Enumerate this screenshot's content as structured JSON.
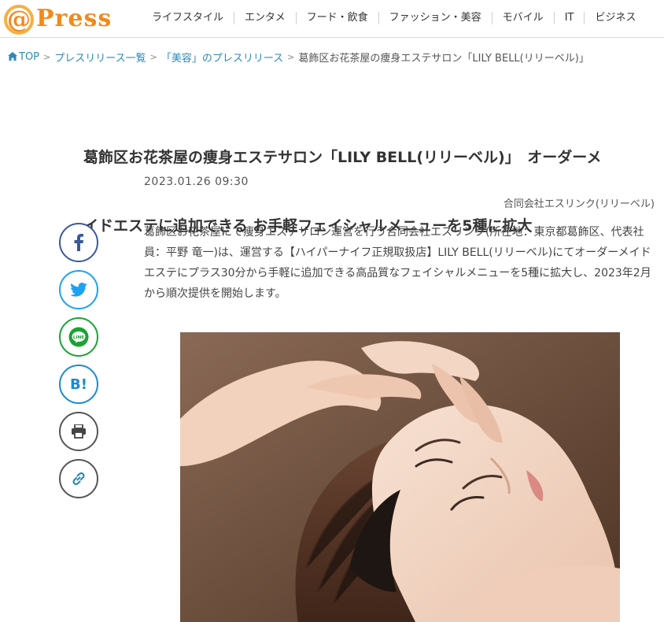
{
  "header": {
    "logo_at": "@",
    "logo_text": "Press",
    "nav": [
      {
        "label": "ライフスタイル"
      },
      {
        "label": "エンタメ"
      },
      {
        "label": "フード・飲食"
      },
      {
        "label": "ファッション・美容"
      },
      {
        "label": "モバイル"
      },
      {
        "label": "IT"
      },
      {
        "label": "ビジネス"
      }
    ]
  },
  "breadcrumb": {
    "home": "TOP",
    "list": "プレスリリース一覧",
    "category": "「美容」のプレスリリース",
    "current": "葛飾区お花茶屋の痩身エステサロン「LILY BELL(リリーベル)」"
  },
  "article": {
    "title_line1": "葛飾区お花茶屋の痩身エステサロン「LILY BELL(リリーベル)」　オーダーメ",
    "title_line2": "イドエステに追加できる お手軽フェイシャルメニューを5種に拡大",
    "date": "2023.01.26 09:30",
    "company": "合同会社エスリンク(リリーベル)",
    "body": "葛飾区お花茶屋にて痩身エステサロン運営を行う合同会社エスリンク(所在地：東京都葛飾区、代表社員：平野 竜一)は、運営する【ハイパーナイフ正規取扱店】LILY BELL(リリーベル)にてオーダーメイドエステにプラス30分から手軽に追加できる高品質なフェイシャルメニューを5種に拡大し、2023年2月から順次提供を開始します。"
  },
  "share": {
    "buttons": [
      {
        "icon": "facebook-icon",
        "color": "#3b5998"
      },
      {
        "icon": "twitter-icon",
        "color": "#1da1f2"
      },
      {
        "icon": "line-icon",
        "color": "#1aa333",
        "text": "LINE"
      },
      {
        "icon": "hatena-bookmark-icon",
        "color": "#1c8ad1",
        "text": "B!"
      },
      {
        "icon": "print-icon",
        "color": "#555555"
      },
      {
        "icon": "link-icon",
        "color": "#555555"
      }
    ]
  },
  "colors": {
    "brand": "#f08a1c",
    "link": "#2a8ab8"
  }
}
